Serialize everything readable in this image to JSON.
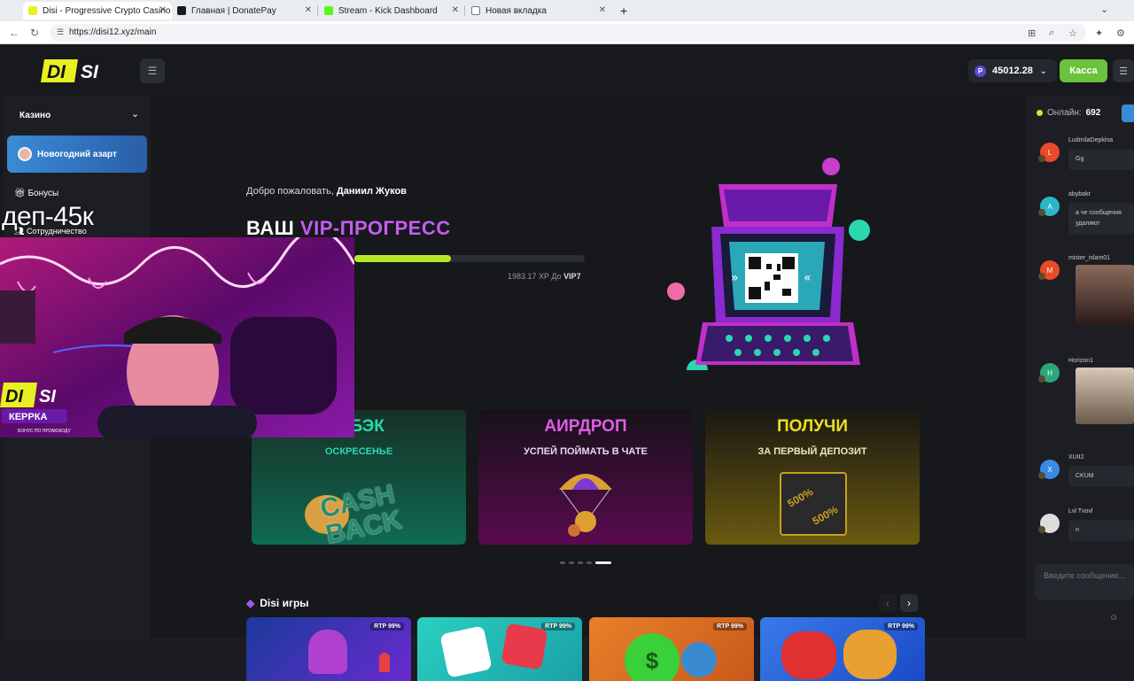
{
  "browser": {
    "tabs": [
      {
        "title": "Disi - Progressive Crypto Casino",
        "active": true
      },
      {
        "title": "Главная | DonatePay",
        "active": false
      },
      {
        "title": "Stream - Kick Dashboard",
        "active": false
      },
      {
        "title": "Новая вкладка",
        "active": false
      }
    ],
    "new_tab": "+",
    "url": "https://disi12.xyz/main"
  },
  "header": {
    "logo_left": "DI",
    "logo_right": "SI",
    "balance": "45012.28",
    "coin_symbol": "P",
    "kassa_label": "Касса"
  },
  "sidebar": {
    "casino_label": "Казино",
    "promo_label": "Новогодний азарт",
    "bonus_label": "Бонусы",
    "partner_label": "Сотрудничество"
  },
  "hero": {
    "welcome_prefix": "Добро пожаловать, ",
    "welcome_name": "Даниил Жуков",
    "vip_word1": "ВАШ",
    "vip_word2": "VIP-ПРОГРЕСС",
    "progress_fraction": 0.42,
    "xp_text": "1983.17 XP До ",
    "xp_level": "VIP7"
  },
  "banners": [
    {
      "title": "ЩБЭК",
      "sub": "ОСКРЕСЕНЬЕ",
      "art": "CASH BACK"
    },
    {
      "title": "АИРДРОП",
      "sub": "УСПЕЙ ПОЙМАТЬ В ЧАТЕ"
    },
    {
      "title": "ПОЛУЧИ",
      "sub": "ЗА ПЕРВЫЙ ДЕПОЗИТ",
      "art": "500%"
    }
  ],
  "games": {
    "title": "Disi игры",
    "prev": "‹",
    "next": "›",
    "rtp": [
      "RTP 99%",
      "RTP 99%",
      "RTP 99%",
      "RTP 99%"
    ]
  },
  "chat": {
    "online_label": "Онлайн:",
    "online_count": "692",
    "messages": [
      {
        "user": "LudmilaDepkina",
        "avatar": "L",
        "text": "Gg"
      },
      {
        "user": "abybakr",
        "avatar": "A",
        "text": "а че сообщения удаляют"
      },
      {
        "user": "mister_islam01",
        "avatar": "M",
        "text": ""
      },
      {
        "user": "Horizon1",
        "avatar": "H",
        "text": ""
      },
      {
        "user": "XUII2",
        "avatar": "X",
        "text": "CKUM"
      },
      {
        "user": "Lvl Tvovl",
        "avatar": "",
        "text": "n"
      }
    ],
    "input_placeholder": "Введите сообщение..."
  },
  "stream_overlay": {
    "text": "деп-45к",
    "cam_logo_left": "DI",
    "cam_logo_right": "SI",
    "cam_name": "КЕРРКА",
    "cam_caption": "БОНУС ПО ПРОМОКОДУ"
  },
  "colors": {
    "accent_green": "#6cc23a",
    "vip_purple": "#c85cf0",
    "progress": "#b6e82a",
    "logo_yellow": "#e8f020"
  }
}
